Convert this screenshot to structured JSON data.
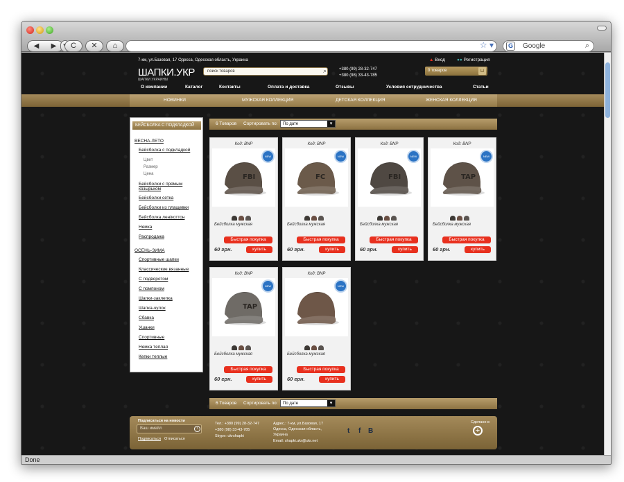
{
  "browser": {
    "nav_back": "◀",
    "nav_forward": "▶",
    "nav_dropdown": "▾",
    "reload": "C",
    "stop": "✕",
    "home": "⌂",
    "url": "",
    "search_placeholder": "Google",
    "status": "Done"
  },
  "header": {
    "address": "7-км, ул.Базовая, 17 Одесса, Одесская область, Украина",
    "login": "Вход",
    "register": "Регистрация",
    "logo": "ШАПКИ.УКР",
    "logo_sub": "ШАПКИ УКРАИНЫ",
    "search_value": "поиск товаров",
    "phone1": "+380 (99) 28-32-747",
    "phone2": "+380 (98) 33-43-785",
    "cart": "0 товаров"
  },
  "top_nav": [
    "О компании",
    "Каталог",
    "Контакты",
    "Оплата и доставка",
    "Отзывы",
    "Условия сотрудничества",
    "Статьи"
  ],
  "categories": [
    "НОВИНКИ",
    "МУЖСКАЯ КОЛЛЕКЦИЯ",
    "ДЕТСКАЯ КОЛЛЕКЦИЯ",
    "ЖЕНСКАЯ КОЛЛЕКЦИЯ"
  ],
  "sidebar": {
    "heading": "БЕЙСБОЛКА С ПОДКЛАДКОЙ",
    "spring": "ВЕСНА-ЛЕТО",
    "spring_items": [
      "Бейсболка с подкладкой",
      "Бейсболки с прямым козырьком",
      "Бейсболки сетка",
      "Бейсболки из плащевки",
      "Бейсболка лен/коттон",
      "Немка",
      "Распродажа"
    ],
    "filters": [
      "Цвет",
      "Размер",
      "Цена"
    ],
    "autumn": "ОСЕНЬ-ЗИМА",
    "autumn_items": [
      "Спортивные шапки",
      "Классические вязанные",
      "С подворотом",
      "С помпоном",
      "Шапки-заклепка",
      "Шапка-чулок",
      "Сбавка",
      "Ушанки",
      "Спортивные",
      "Немка теплая",
      "Кепки теплые"
    ]
  },
  "sortbar": {
    "count": "6 Товаров",
    "sort_label": "Сортировать по:",
    "sort_value": "По дате"
  },
  "products": [
    {
      "code": "Код: BNP",
      "name": "Бейсболка мужская",
      "price": "60 грн.",
      "fast": "Быстрая покупка",
      "buy": "купить",
      "logo": "FBI",
      "color": "#5a4f45"
    },
    {
      "code": "Код: BNP",
      "name": "Бейсболка мужская",
      "price": "60 грн.",
      "fast": "Быстрая покупка",
      "buy": "купить",
      "logo": "FC",
      "color": "#6b5a4a"
    },
    {
      "code": "Код: BNP",
      "name": "Бейсболка мужская",
      "price": "60 грн.",
      "fast": "Быстрая покупка",
      "buy": "купить",
      "logo": "FBI",
      "color": "#4f4842"
    },
    {
      "code": "Код: BNP",
      "name": "Бейсболка мужская",
      "price": "60 грн.",
      "fast": "Быстрая покупка",
      "buy": "купить",
      "logo": "TAP",
      "color": "#5e5248"
    },
    {
      "code": "Код: BNP",
      "name": "Бейсболка мужская",
      "price": "60 грн.",
      "fast": "Быстрая покупка",
      "buy": "купить",
      "logo": "TAP",
      "color": "#6f6b66"
    },
    {
      "code": "Код: BNP",
      "name": "Бейсболка мужская",
      "price": "60 грн.",
      "fast": "Быстрая покупка",
      "buy": "купить",
      "logo": "",
      "color": "#6e5748"
    }
  ],
  "footer": {
    "subscribe_title": "Подписаться на новости",
    "email_placeholder": "Ваш имейл",
    "subscribe_link": "Подписаться",
    "unsubscribe_link": "Отписаться",
    "tel1": "Тел.: +380 (99) 28-32-747",
    "tel2": "+380 (98) 33-43-785",
    "skype": "Skype: ukrshapki",
    "addr1": "Адрес.: 7-км, ул.Базовая, 17",
    "addr2": "Одесса, Одесская область,",
    "addr3": "Украина",
    "email": "Email: shapki.ukr@ukr.net",
    "made_by": "Сделано в",
    "twitter": "t",
    "facebook": "f",
    "vk": "B",
    "plus": "+"
  }
}
